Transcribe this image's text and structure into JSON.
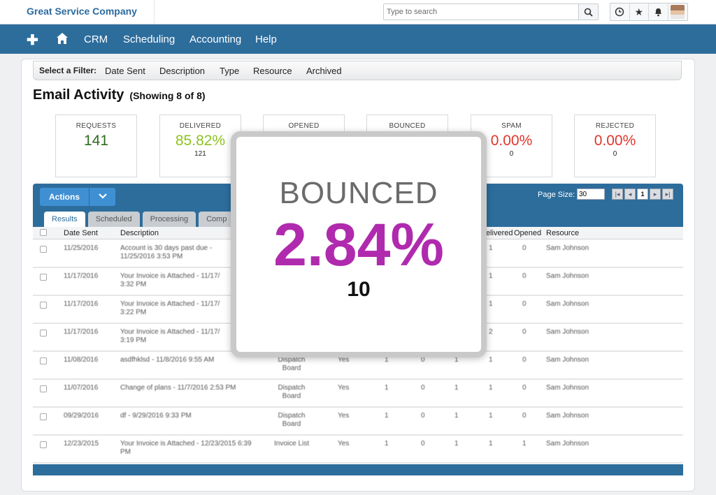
{
  "header": {
    "brand": "Great Service Company",
    "search_placeholder": "Type to search",
    "icons": [
      "search-icon",
      "clock-icon",
      "star-icon",
      "bell-icon",
      "avatar"
    ]
  },
  "nav": {
    "items": [
      "CRM",
      "Scheduling",
      "Accounting",
      "Help"
    ],
    "icons": [
      "plus-icon",
      "home-icon"
    ]
  },
  "filter": {
    "label": "Select a Filter:",
    "items": [
      "Date Sent",
      "Description",
      "Type",
      "Resource",
      "Archived"
    ]
  },
  "page": {
    "title": "Email Activity",
    "subtitle": "(Showing 8 of 8)"
  },
  "stats": [
    {
      "label": "REQUESTS",
      "value": "141",
      "count": "",
      "color": "#2f6b1f"
    },
    {
      "label": "DELIVERED",
      "value": "85.82%",
      "count": "121",
      "color": "#8dc21f"
    },
    {
      "label": "OPENED",
      "value": "",
      "count": "",
      "color": "#222222"
    },
    {
      "label": "BOUNCED",
      "value": "",
      "count": "",
      "color": "#222222"
    },
    {
      "label": "SPAM",
      "value": "0.00%",
      "count": "0",
      "color": "#e0362c"
    },
    {
      "label": "REJECTED",
      "value": "0.00%",
      "count": "0",
      "color": "#e0362c"
    }
  ],
  "grid": {
    "actions_label": "Actions",
    "page_size_label": "Page Size:",
    "page_size_value": "30",
    "current_page": "1",
    "tabs": [
      "Results",
      "Scheduled",
      "Processing",
      "Comp"
    ],
    "columns": [
      "Date Sent",
      "Description",
      "Delivered",
      "Opened",
      "Resource"
    ],
    "rows": [
      {
        "date": "11/25/2016",
        "desc": "Account is 30 days past due - 11/25/2016 3:53 PM",
        "type": "",
        "sent": "",
        "c1": "",
        "c2": "",
        "c3": "",
        "delivered": "1",
        "opened": "0",
        "resource": "Sam Johnson"
      },
      {
        "date": "11/17/2016",
        "desc": "Your Invoice is Attached - 11/17/ 3:32 PM",
        "type": "",
        "sent": "",
        "c1": "",
        "c2": "",
        "c3": "",
        "delivered": "1",
        "opened": "0",
        "resource": "Sam Johnson"
      },
      {
        "date": "11/17/2016",
        "desc": "Your Invoice is Attached - 11/17/ 3:22 PM",
        "type": "",
        "sent": "",
        "c1": "",
        "c2": "",
        "c3": "",
        "delivered": "1",
        "opened": "0",
        "resource": "Sam Johnson"
      },
      {
        "date": "11/17/2016",
        "desc": "Your Invoice is Attached - 11/17/ 3:19 PM",
        "type": "",
        "sent": "",
        "c1": "",
        "c2": "",
        "c3": "",
        "delivered": "2",
        "opened": "0",
        "resource": "Sam Johnson"
      },
      {
        "date": "11/08/2016",
        "desc": "asdfhklsd - 11/8/2016 9:55 AM",
        "type": "Dispatch Board",
        "sent": "Yes",
        "c1": "1",
        "c2": "0",
        "c3": "1",
        "delivered": "1",
        "opened": "0",
        "resource": "Sam Johnson"
      },
      {
        "date": "11/07/2016",
        "desc": "Change of plans - 11/7/2016 2:53 PM",
        "type": "Dispatch Board",
        "sent": "Yes",
        "c1": "1",
        "c2": "0",
        "c3": "1",
        "delivered": "1",
        "opened": "0",
        "resource": "Sam Johnson"
      },
      {
        "date": "09/29/2016",
        "desc": "df - 9/29/2016 9:33 PM",
        "type": "Dispatch Board",
        "sent": "Yes",
        "c1": "1",
        "c2": "0",
        "c3": "1",
        "delivered": "1",
        "opened": "0",
        "resource": "Sam Johnson"
      },
      {
        "date": "12/23/2015",
        "desc": "Your Invoice is Attached - 12/23/2015 6:39 PM",
        "type": "Invoice List",
        "sent": "Yes",
        "c1": "1",
        "c2": "0",
        "c3": "1",
        "delivered": "1",
        "opened": "1",
        "resource": "Sam Johnson"
      }
    ]
  },
  "overlay": {
    "label": "BOUNCED",
    "value": "2.84%",
    "count": "10",
    "color": "#b02aae"
  }
}
